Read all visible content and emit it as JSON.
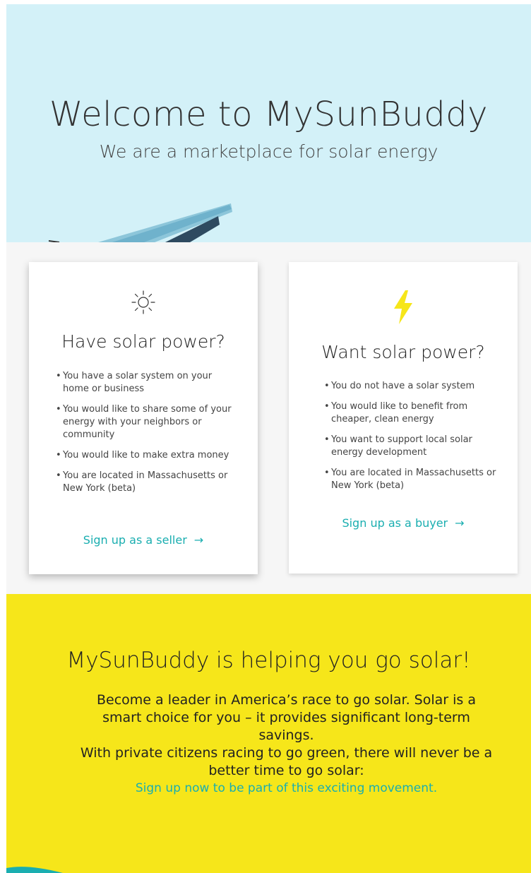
{
  "hero": {
    "title": "Welcome to MySunBuddy",
    "subtitle": "We are a marketplace for solar energy"
  },
  "cards": {
    "seller": {
      "icon": "sun-icon",
      "title": "Have solar power?",
      "items": [
        "You have a solar system on your home or business",
        "You would like to share some of your energy with your neighbors or community",
        "You would like to make extra money",
        "You are located in Massachusetts or New York (beta)"
      ],
      "cta": "Sign up as a seller",
      "arrow": "→"
    },
    "buyer": {
      "icon": "lightning-bolt-icon",
      "title": "Want solar power?",
      "items": [
        "You do not have a solar system",
        "You would like to benefit from cheaper, clean energy",
        "You want to support local solar energy development",
        "You are located in Massachusetts or New York (beta)"
      ],
      "cta": "Sign up as a buyer",
      "arrow": "→"
    }
  },
  "promo": {
    "title": "MySunBuddy is helping you go solar!",
    "paragraph1": "Become a leader in America’s race to go solar. Solar is a smart choice for you – it provides significant long-term savings.",
    "paragraph2": "With private citizens racing to go green, there will never be a better time to go solar:",
    "link": "Sign up now to be part of this exciting movement."
  },
  "colors": {
    "hero_bg": "#d3f1f8",
    "accent": "#1aaeb0",
    "promo_bg": "#f6e61a",
    "bolt": "#f6e61a"
  }
}
